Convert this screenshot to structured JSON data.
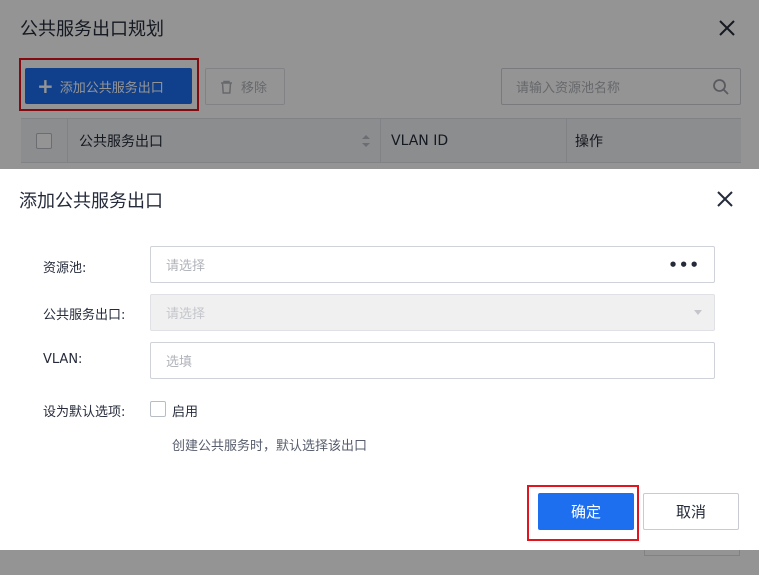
{
  "background_dialog": {
    "title": "公共服务出口规划",
    "add_button_label": "添加公共服务出口",
    "remove_button_label": "移除",
    "search_placeholder": "请输入资源池名称",
    "table_headers": [
      "公共服务出口",
      "VLAN ID",
      "操作"
    ]
  },
  "dialog": {
    "title": "添加公共服务出口",
    "fields": {
      "resource_pool": {
        "label": "资源池:",
        "placeholder": "请选择"
      },
      "service_exit": {
        "label": "公共服务出口:",
        "placeholder": "请选择"
      },
      "vlan": {
        "label": "VLAN:",
        "placeholder": "选填"
      },
      "default_option": {
        "label": "设为默认选项:",
        "checkbox_label": "启用",
        "checked": false
      }
    },
    "help_text": "创建公共服务时，默认选择该出口",
    "ok_label": "确定",
    "cancel_label": "取消"
  },
  "colors": {
    "primary": "#1d6ff0",
    "highlight_outline": "#e2141d"
  }
}
